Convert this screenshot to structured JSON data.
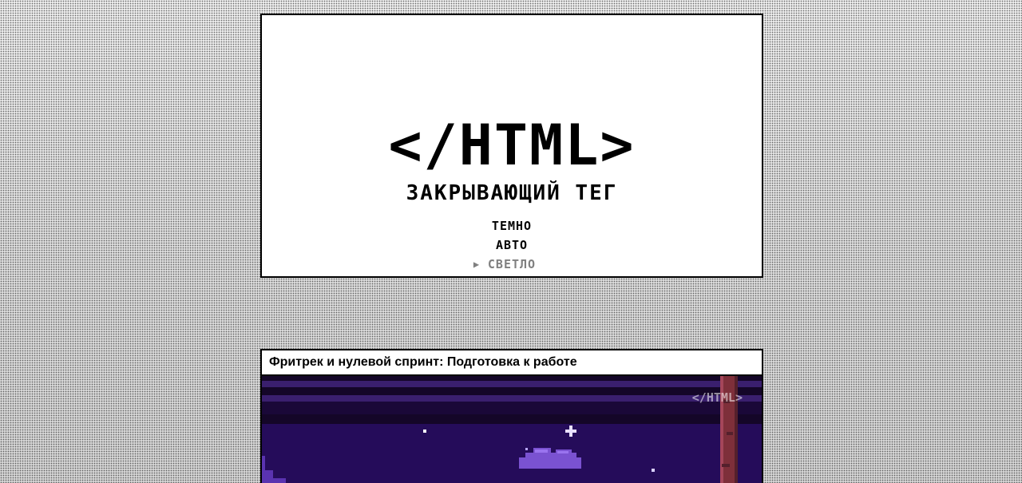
{
  "site": {
    "logo_text": "</HTML>",
    "tagline": "ЗАКРЫВАЮЩИЙ ТЕГ"
  },
  "theme_switcher": {
    "options": [
      {
        "label": "ТЕМНО",
        "active": false
      },
      {
        "label": "АВТО",
        "active": false
      },
      {
        "label": "СВЕТЛО",
        "active": true
      }
    ],
    "marker": "▶"
  },
  "article": {
    "title": "Фритрек и нулевой спринт: Подготовка к работе",
    "cover_watermark": "</HTML>"
  },
  "colors": {
    "background": "#e4e4e4",
    "card": "#ffffff",
    "border": "#000000",
    "active_option": "#808080",
    "cover_sky": "#1f0a4a",
    "cover_stripes": "#3a1f7a",
    "cloud": "#7a52d1",
    "pole": "#8a3a3a"
  }
}
